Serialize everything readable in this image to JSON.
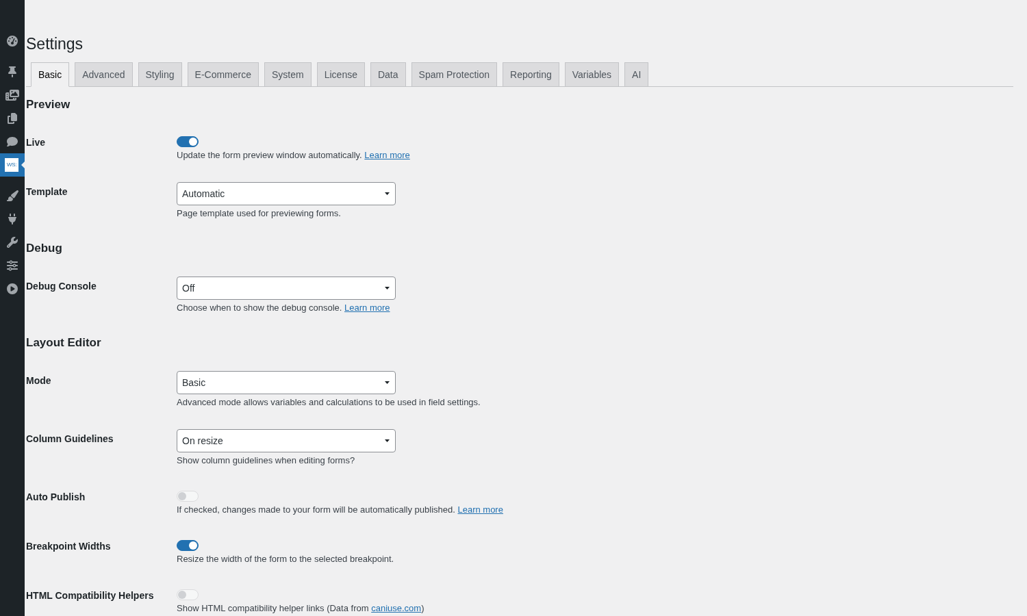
{
  "sidebar": {
    "groups": [
      {
        "items": [
          {
            "selected": false
          }
        ]
      },
      {
        "items": [
          {
            "selected": false
          },
          {
            "selected": false
          },
          {
            "selected": false
          },
          {
            "selected": false
          },
          {
            "selected": true,
            "logo_text": "WS:"
          }
        ]
      },
      {
        "items": [
          {
            "selected": false
          },
          {
            "selected": false
          },
          {
            "selected": false
          },
          {
            "selected": false
          },
          {
            "selected": false
          }
        ]
      }
    ]
  },
  "page": {
    "title": "Settings"
  },
  "tabs": [
    {
      "label": "Basic",
      "selected": true
    },
    {
      "label": "Advanced",
      "selected": false
    },
    {
      "label": "Styling",
      "selected": false
    },
    {
      "label": "E-Commerce",
      "selected": false
    },
    {
      "label": "System",
      "selected": false
    },
    {
      "label": "License",
      "selected": false
    },
    {
      "label": "Data",
      "selected": false
    },
    {
      "label": "Spam Protection",
      "selected": false
    },
    {
      "label": "Reporting",
      "selected": false
    },
    {
      "label": "Variables",
      "selected": false
    },
    {
      "label": "AI",
      "selected": false
    }
  ],
  "sections": [
    {
      "heading": "Preview",
      "rows": [
        {
          "label": "Live",
          "kind": "toggle",
          "on": true,
          "description": {
            "text": "Update the form preview window automatically.",
            "link": "Learn more"
          }
        },
        {
          "label": "Template",
          "kind": "select",
          "value": "Automatic",
          "description": {
            "text": "Page template used for previewing forms."
          }
        }
      ]
    },
    {
      "heading": "Debug",
      "rows": [
        {
          "label": "Debug Console",
          "kind": "select",
          "value": "Off",
          "description": {
            "text": "Choose when to show the debug console.",
            "link": "Learn more"
          }
        }
      ]
    },
    {
      "heading": "Layout Editor",
      "rows": [
        {
          "label": "Mode",
          "kind": "select",
          "value": "Basic",
          "description": {
            "text": "Advanced mode allows variables and calculations to be used in field settings."
          }
        },
        {
          "label": "Column Guidelines",
          "kind": "select",
          "value": "On resize",
          "description": {
            "text": "Show column guidelines when editing forms?"
          }
        },
        {
          "label": "Auto Publish",
          "kind": "toggle",
          "on": false,
          "description": {
            "text": "If checked, changes made to your form will be automatically published.",
            "link": "Learn more"
          }
        },
        {
          "label": "Breakpoint Widths",
          "kind": "toggle",
          "on": true,
          "description": {
            "text": "Resize the width of the form to the selected breakpoint."
          }
        },
        {
          "label": "HTML Compatibility Helpers",
          "kind": "toggle",
          "on": false,
          "description": {
            "text": "Show HTML compatibility helper links (Data from",
            "link": "caniuse.com",
            "text_after": ")"
          }
        }
      ]
    }
  ]
}
